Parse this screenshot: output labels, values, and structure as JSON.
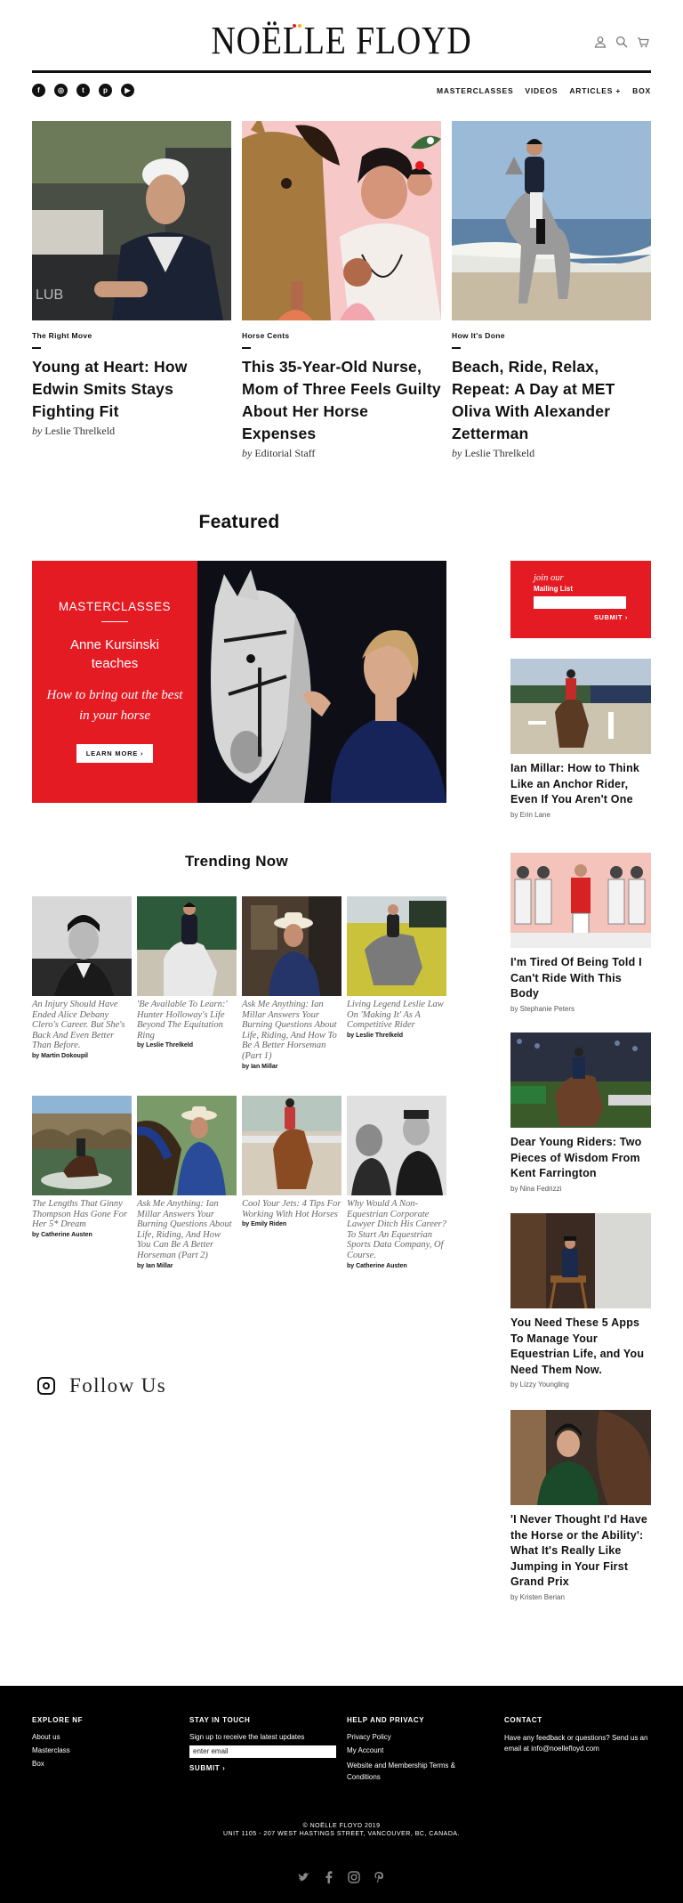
{
  "header": {
    "logo": "NOËLLE FLOYD",
    "brand_colors": {
      "dot1": "#e51b24",
      "dot2": "#f5b400",
      "accent_red": "#e51b24"
    },
    "icons": [
      "account-icon",
      "search-icon",
      "cart-icon"
    ]
  },
  "nav": {
    "socials": [
      "facebook-icon",
      "instagram-icon",
      "twitter-icon",
      "pinterest-icon",
      "youtube-icon"
    ],
    "items": [
      "MASTERCLASSES",
      "VIDEOS",
      "ARTICLES +",
      "BOX"
    ]
  },
  "top_articles": [
    {
      "category": "The Right Move",
      "title": "Young at Heart: How Edwin Smits Stays Fighting Fit",
      "by": "by",
      "author": "Leslie Threlkeld"
    },
    {
      "category": "Horse Cents",
      "title": "This 35-Year-Old Nurse, Mom of Three Feels Guilty About Her Horse Expenses",
      "by": "by",
      "author": "Editorial Staff"
    },
    {
      "category": "How It's Done",
      "title": "Beach, Ride, Relax, Repeat: A Day at MET Oliva With Alexander Zetterman",
      "by": "by",
      "author": "Leslie Threlkeld"
    }
  ],
  "featured": {
    "heading": "Featured",
    "label": "MASTERCLASSES",
    "teacher": "Anne Kursinski teaches",
    "topic": "How to bring out the best in your horse",
    "cta": "LEARN MORE ›"
  },
  "trending": {
    "heading": "Trending Now",
    "items": [
      {
        "title": "An Injury Should Have Ended Alice Debany Clero's Career. But She's Back And Even Better Than Before.",
        "author": "by Martin Dokoupil"
      },
      {
        "title": "'Be Available To Learn:' Hunter Holloway's Life Beyond The Equitation Ring",
        "author": "by Leslie Threlkeld"
      },
      {
        "title": "Ask Me Anything: Ian Millar Answers Your Burning Questions About Life, Riding, And How To Be A Better Horseman (Part 1)",
        "author": "by Ian Millar"
      },
      {
        "title": "Living Legend Leslie Law On 'Making It' As A Competitive Rider",
        "author": "by Leslie Threlkeld"
      },
      {
        "title": "The Lengths That Ginny Thompson Has Gone For Her 5* Dream",
        "author": "by Catherine Austen"
      },
      {
        "title": "Ask Me Anything: Ian Millar Answers Your Burning Questions About Life, Riding, And How You Can Be A Better Horseman (Part 2)",
        "author": "by Ian Millar"
      },
      {
        "title": "Cool Your Jets: 4 Tips For Working With Hot Horses",
        "author": "by Emily Riden"
      },
      {
        "title": "Why Would A Non-Equestrian Corporate Lawyer Ditch His Career? To Start An Equestrian Sports Data Company, Of Course.",
        "author": "by Catherine Austen"
      }
    ]
  },
  "follow": {
    "label": "Follow Us"
  },
  "mailing": {
    "join": "join our",
    "list": "Mailing List",
    "submit": "SUBMIT ›"
  },
  "sidebar": [
    {
      "title": "Ian Millar: How to Think Like an Anchor Rider, Even If You Aren't One",
      "author": "by Erin Lane"
    },
    {
      "title": "I'm Tired Of Being Told I Can't Ride With This Body",
      "author": "by Stephanie Peters"
    },
    {
      "title": "Dear Young Riders: Two Pieces of Wisdom From Kent Farrington",
      "author": "by Nina Fedrizzi"
    },
    {
      "title": "You Need These 5 Apps To Manage Your Equestrian Life, and You Need Them Now.",
      "author": "by Lizzy Youngling"
    },
    {
      "title": "'I Never Thought I'd Have the Horse or the Ability': What It's Really Like Jumping in Your First Grand Prix",
      "author": "by Kristen Berian"
    }
  ],
  "footer": {
    "explore": {
      "heading": "EXPLORE NF",
      "links": [
        "About us",
        "Masterclass",
        "Box"
      ]
    },
    "touch": {
      "heading": "STAY IN TOUCH",
      "text": "Sign up to receive the latest updates",
      "placeholder": "enter email",
      "submit": "SUBMIT ›"
    },
    "help": {
      "heading": "HELP AND PRIVACY",
      "links": [
        "Privacy Policy",
        "My Account",
        "Website and Membership Terms & Conditions"
      ]
    },
    "contact": {
      "heading": "CONTACT",
      "text": "Have any feedback or questions? Send us an email at info@noellefloyd.com"
    },
    "copyright": "© NOËLLE FLOYD 2019",
    "address": "UNIT 1105 - 207 WEST HASTINGS STREET, VANCOUVER, BC, CANADA.",
    "socials": [
      "twitter-icon",
      "facebook-icon",
      "instagram-icon",
      "pinterest-icon"
    ]
  }
}
